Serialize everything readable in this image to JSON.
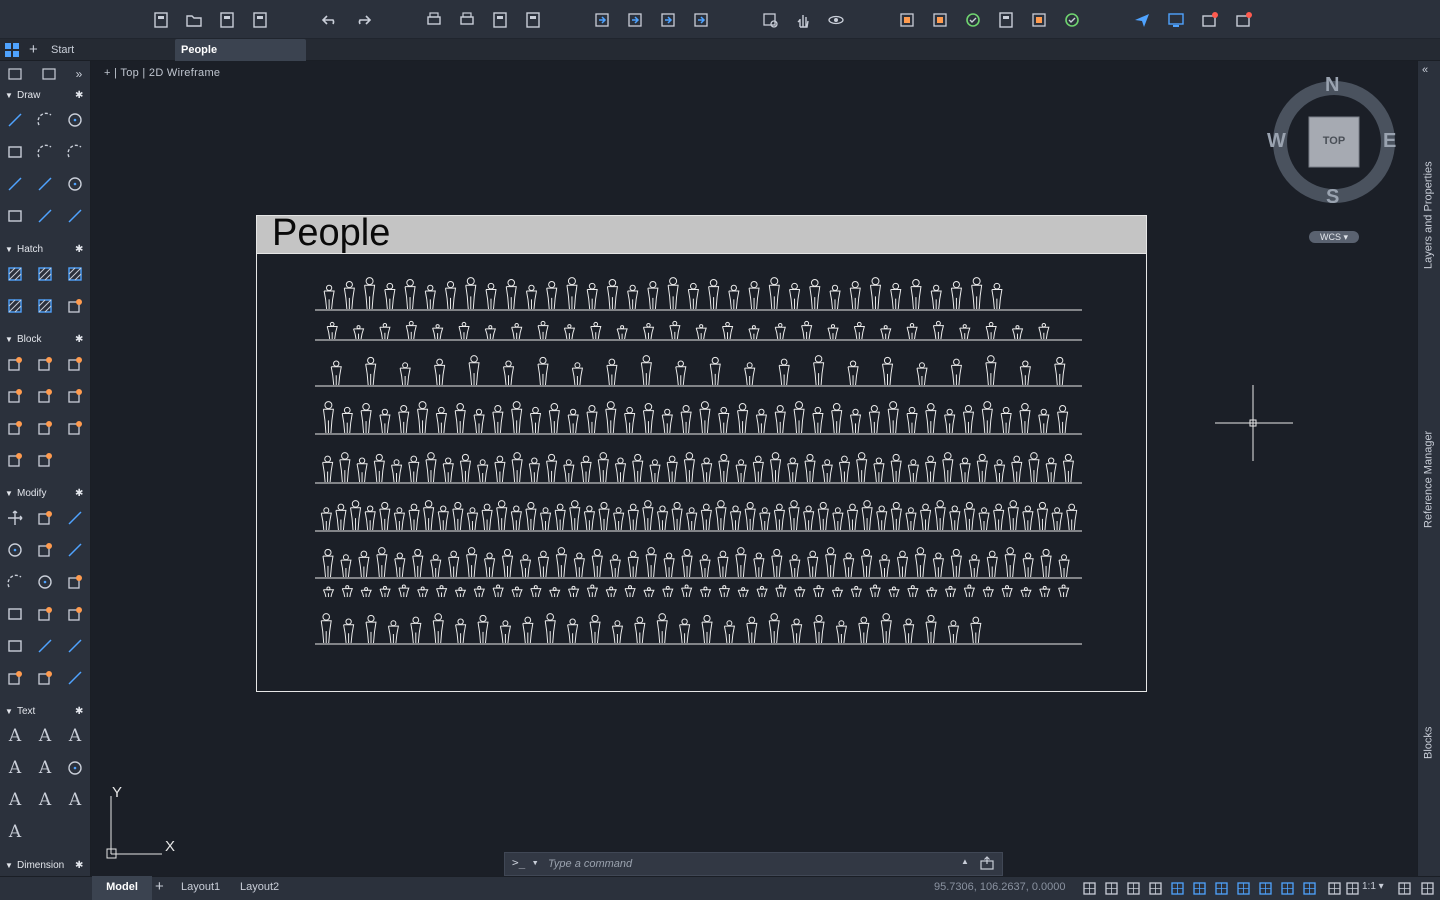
{
  "toolbar": {
    "groups": [
      {
        "icons": [
          "new-file-icon",
          "open-file-icon",
          "save-icon",
          "save-as-icon"
        ]
      },
      {
        "icons": [
          "undo-icon",
          "redo-icon"
        ]
      },
      {
        "icons": [
          "plot-icon",
          "batch-plot-icon",
          "publish-icon",
          "export-pdf-icon"
        ]
      },
      {
        "icons": [
          "import-icon",
          "export-icon",
          "attach-icon",
          "share-icon"
        ]
      },
      {
        "icons": [
          "zoom-window-icon",
          "pan-icon",
          "orbit-icon"
        ]
      },
      {
        "icons": [
          "layer-properties-icon",
          "match-properties-icon",
          "lisp-icon",
          "sheet-set-icon",
          "tool-palette-icon",
          "design-center-icon"
        ]
      },
      {
        "icons": [
          "send-icon",
          "monitor-icon",
          "updates-icon",
          "app-store-icon"
        ]
      }
    ]
  },
  "tabs": {
    "start_label": "Start",
    "active_label": "People"
  },
  "viewport": {
    "label": "+ | Top | 2D Wireframe"
  },
  "palette": {
    "sections": [
      {
        "label": "Draw"
      },
      {
        "label": "Hatch"
      },
      {
        "label": "Block"
      },
      {
        "label": "Modify"
      },
      {
        "label": "Text"
      },
      {
        "label": "Dimension"
      }
    ]
  },
  "drawing": {
    "title": "People"
  },
  "compass": {
    "north": "N",
    "south": "S",
    "east": "E",
    "west": "W",
    "cube_label": "TOP",
    "ucs_label": "WCS"
  },
  "ucs_axes": {
    "x": "X",
    "y": "Y"
  },
  "right_panel": {
    "tabs": [
      "Layers and Properties",
      "Reference Manager",
      "Blocks"
    ]
  },
  "command": {
    "prompt": ">_ ▾",
    "placeholder": "Type a command"
  },
  "status": {
    "layouts": [
      "Model",
      "Layout1",
      "Layout2"
    ],
    "coordinates": "95.7306, 106.2637, 0.0000",
    "scale": "1:1"
  }
}
